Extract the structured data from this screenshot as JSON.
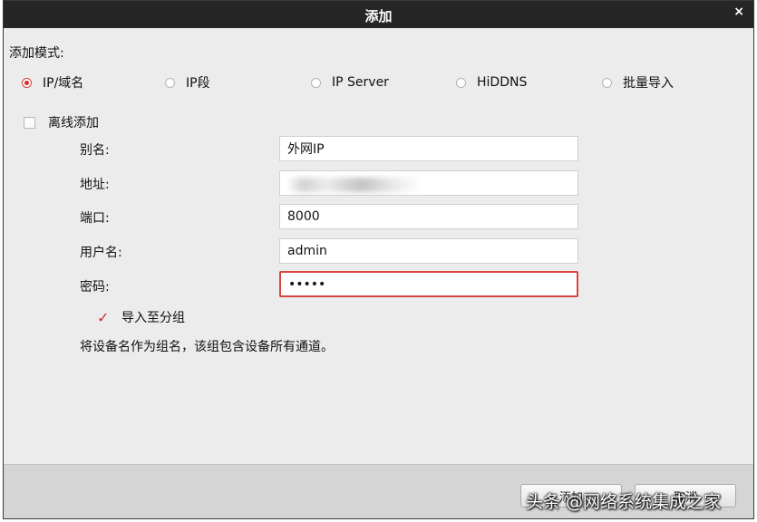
{
  "window": {
    "title": "添加",
    "close_symbol": "×"
  },
  "mode": {
    "label": "添加模式:",
    "options": [
      {
        "label": "IP/域名",
        "selected": true
      },
      {
        "label": "IP段",
        "selected": false
      },
      {
        "label": "IP Server",
        "selected": false
      },
      {
        "label": "HiDDNS",
        "selected": false
      },
      {
        "label": "批量导入",
        "selected": false
      }
    ]
  },
  "offline": {
    "label": "离线添加",
    "checked": false
  },
  "fields": {
    "alias": {
      "label": "别名:",
      "value": "外网IP"
    },
    "address": {
      "label": "地址:",
      "value": "",
      "note": "value obscured"
    },
    "port": {
      "label": "端口:",
      "value": "8000"
    },
    "username": {
      "label": "用户名:",
      "value": "admin"
    },
    "password": {
      "label": "密码:",
      "value": "12345"
    }
  },
  "import_group": {
    "label": "导入至分组",
    "checked": true
  },
  "note": "将设备名作为组名，该组包含设备所有通道。",
  "buttons": {
    "add": "添加",
    "cancel": "取消"
  },
  "watermark": "头条 @网络系统集成之家",
  "icons": {
    "close": "close-icon",
    "check": "check-icon"
  },
  "colors": {
    "accent": "#d92b2b",
    "titlebar": "#262626",
    "background": "#ececec"
  }
}
